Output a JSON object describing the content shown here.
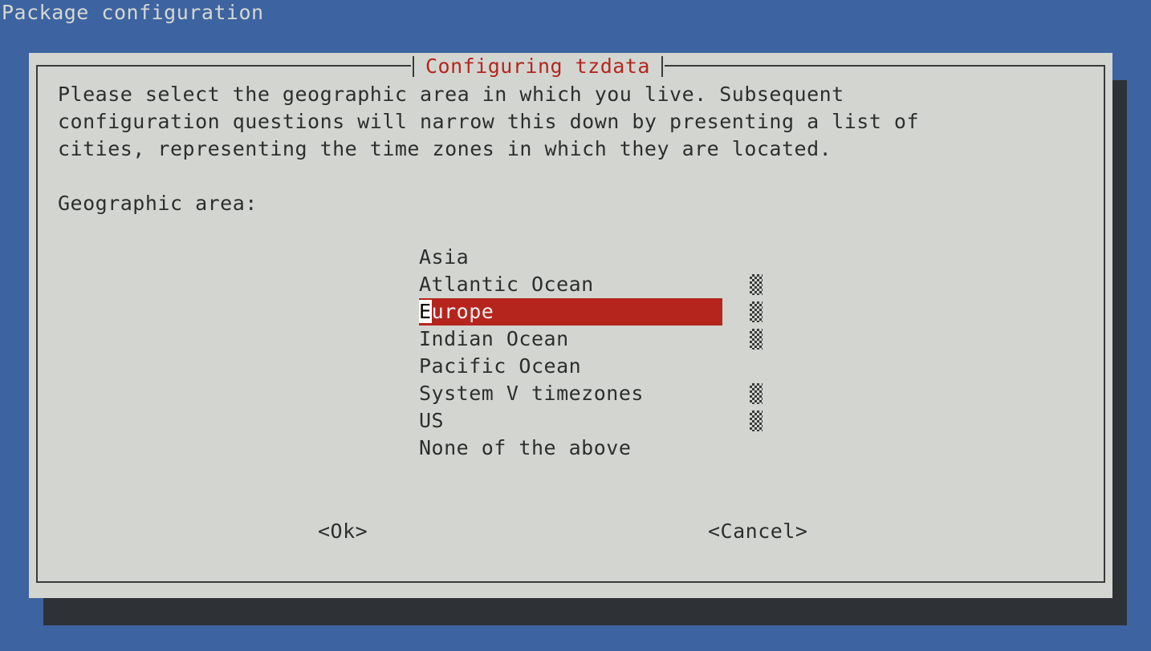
{
  "backtitle": "Package configuration",
  "dialog": {
    "title": "Configuring tzdata",
    "description_lines": [
      "Please select the geographic area in which you live. Subsequent",
      "configuration questions will narrow this down by presenting a list of",
      "cities, representing the time zones in which they are located."
    ],
    "prompt": "Geographic area:",
    "menu_items": [
      {
        "label": "Asia"
      },
      {
        "label": "Atlantic Ocean"
      },
      {
        "label": "Europe",
        "hotkey": "E",
        "rest": "urope"
      },
      {
        "label": "Indian Ocean"
      },
      {
        "label": "Pacific Ocean"
      },
      {
        "label": "System V timezones"
      },
      {
        "label": "US"
      },
      {
        "label": "None of the above"
      }
    ],
    "ok_label": "<Ok>",
    "cancel_label": "<Cancel>"
  },
  "colors": {
    "background": "#3d64a0",
    "dialog": "#d3d6d0",
    "title": "#b5251e",
    "selection": "#b5251e",
    "shadow": "#2e3236"
  }
}
